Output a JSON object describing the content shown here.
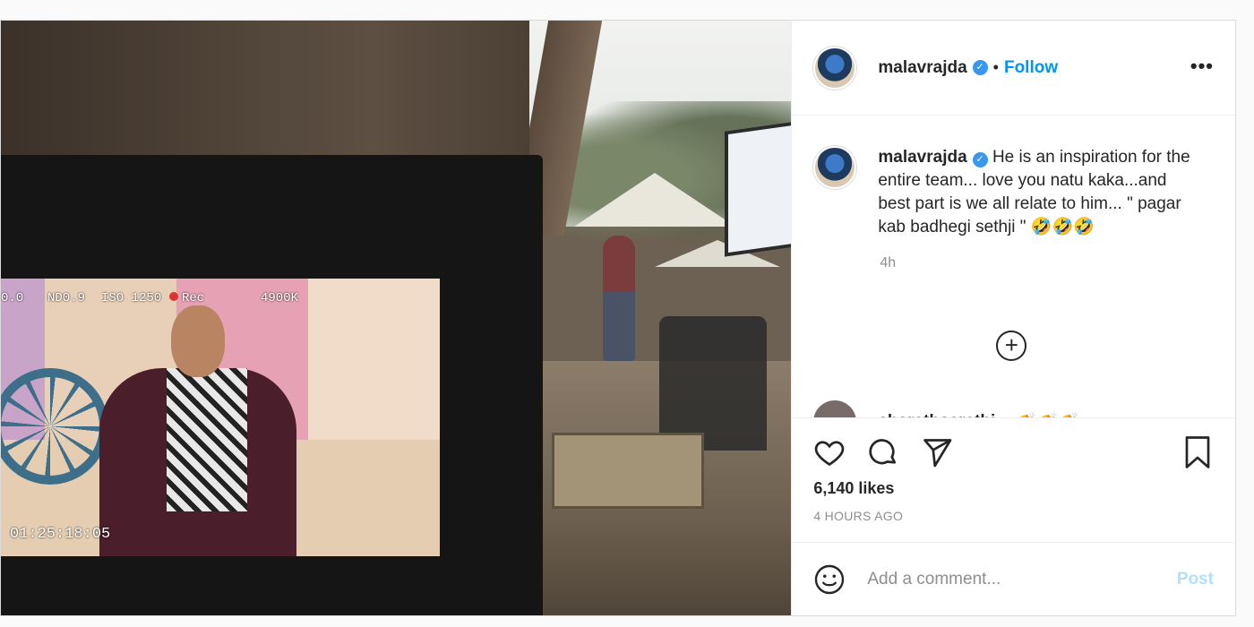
{
  "header": {
    "username": "malavrajda",
    "separator": "•",
    "follow_label": "Follow",
    "more_label": "•••"
  },
  "caption": {
    "username": "malavrajda",
    "text": "He is an inspiration for the entire team... love you natu kaka...and best part is we all relate to him... \" pagar kab badhegi sethji \" 🤣🤣🤣",
    "time": "4h"
  },
  "load_more_label": "+",
  "next_comment": {
    "username": "sharathsarathi",
    "emoji": "👏👏👏"
  },
  "photo_hud": {
    "left_value": "0.0",
    "nd": "ND0.9",
    "iso": "ISO 1250",
    "rec": "Rec",
    "kelvin": "4900K",
    "timecode": "01:25:18:05"
  },
  "engagement": {
    "likes": "6,140 likes",
    "posted_ago": "4 HOURS AGO"
  },
  "comment_box": {
    "placeholder": "Add a comment...",
    "post_label": "Post"
  },
  "colors": {
    "link_blue": "#0095f6",
    "verified_blue": "#3897f0",
    "disabled_post": "#b2dffc",
    "muted_text": "#8e8e8e"
  },
  "icons": [
    "verified-badge-icon",
    "more-options-icon",
    "load-more-icon",
    "heart-icon",
    "comment-icon",
    "share-icon",
    "bookmark-icon",
    "emoji-icon"
  ]
}
